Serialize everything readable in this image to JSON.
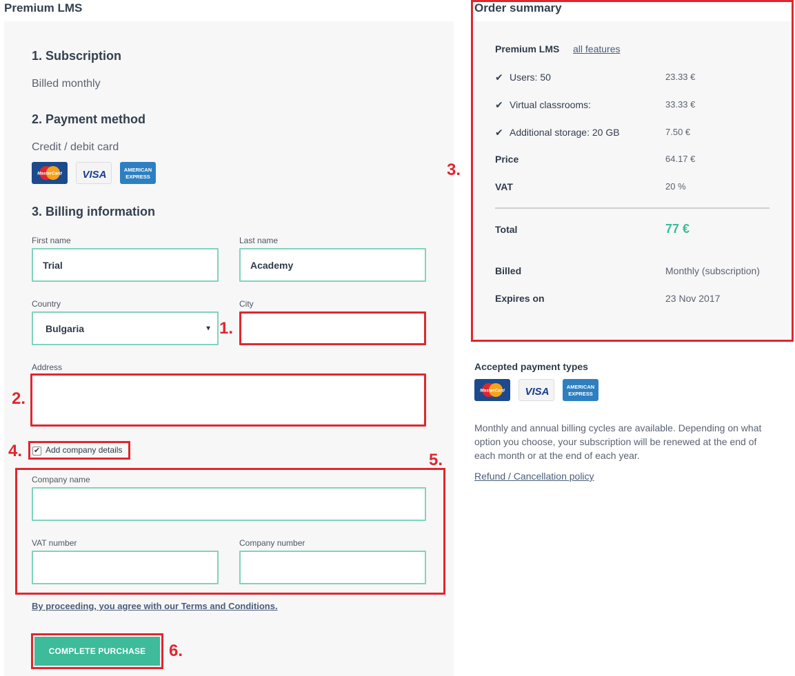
{
  "page": {
    "title": "Premium LMS"
  },
  "subscription": {
    "heading": "1. Subscription",
    "text": "Billed monthly"
  },
  "payment": {
    "heading": "2. Payment method",
    "text": "Credit / debit card",
    "cards": [
      {
        "name": "mastercard",
        "label": "MasterCard"
      },
      {
        "name": "visa",
        "label": "VISA"
      },
      {
        "name": "amex",
        "label": "AMERICAN EXPRESS"
      }
    ]
  },
  "billing": {
    "heading": "3. Billing information",
    "first_name_label": "First name",
    "first_name_value": "Trial",
    "last_name_label": "Last name",
    "last_name_value": "Academy",
    "country_label": "Country",
    "country_value": "Bulgaria",
    "city_label": "City",
    "city_value": "",
    "address_label": "Address",
    "address_value": "",
    "company_checkbox_label": "Add company details",
    "company_checkbox_checked": true,
    "company_name_label": "Company name",
    "company_name_value": "",
    "vat_number_label": "VAT number",
    "vat_number_value": "",
    "company_number_label": "Company number",
    "company_number_value": "",
    "terms_text": "By proceeding, you agree with our Terms and Conditions.",
    "purchase_button": "COMPLETE PURCHASE"
  },
  "annotations": {
    "a1": "1.",
    "a2": "2.",
    "a3": "3.",
    "a4": "4.",
    "a5": "5.",
    "a6": "6."
  },
  "summary": {
    "title": "Order summary",
    "product": "Premium LMS",
    "features_link": "all features",
    "lines": [
      {
        "label": "Users: 50",
        "value": "23.33 €"
      },
      {
        "label": "Virtual classrooms:",
        "value": "33.33 €"
      },
      {
        "label": "Additional storage: 20 GB",
        "value": "7.50 €"
      }
    ],
    "price_label": "Price",
    "price_value": "64.17 €",
    "vat_label": "VAT",
    "vat_value": "20 %",
    "total_label": "Total",
    "total_value": "77 €",
    "billed_label": "Billed",
    "billed_value": "Monthly (subscription)",
    "expires_label": "Expires on",
    "expires_value": "23 Nov 2017"
  },
  "accepted": {
    "heading": "Accepted payment types",
    "info": "Monthly and annual billing cycles are available. Depending on what option you choose, your subscription will be renewed at the end of each month or at the end of each year.",
    "refund_link": "Refund / Cancellation policy"
  },
  "colors": {
    "accent": "#3dbb9a",
    "annotation_red": "#e0262e",
    "input_border": "#7fd3be"
  }
}
